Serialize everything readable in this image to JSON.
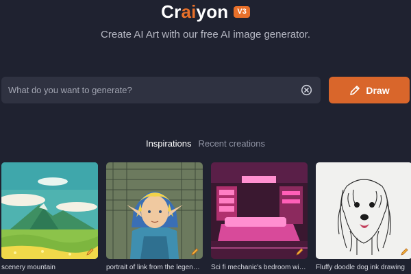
{
  "brand": {
    "name_pre": "Cr",
    "name_accent": "ai",
    "name_post": "yon",
    "version": "V3",
    "accent_color": "#e8702a"
  },
  "tagline": "Create AI Art with our free AI image generator.",
  "search": {
    "placeholder": "What do you want to generate?",
    "value": "",
    "clear_icon": "close-circle-icon"
  },
  "draw_button": {
    "label": "Draw",
    "icon": "pencil-icon"
  },
  "tabs": [
    {
      "label": "Inspirations",
      "active": true
    },
    {
      "label": "Recent creations",
      "active": false
    }
  ],
  "gallery": [
    {
      "caption": "scenery mountain"
    },
    {
      "caption": "portrait of link from the legend of zelda"
    },
    {
      "caption": "Sci fi mechanic's bedroom with neon lights"
    },
    {
      "caption": "Fluffy doodle dog ink drawing"
    }
  ]
}
